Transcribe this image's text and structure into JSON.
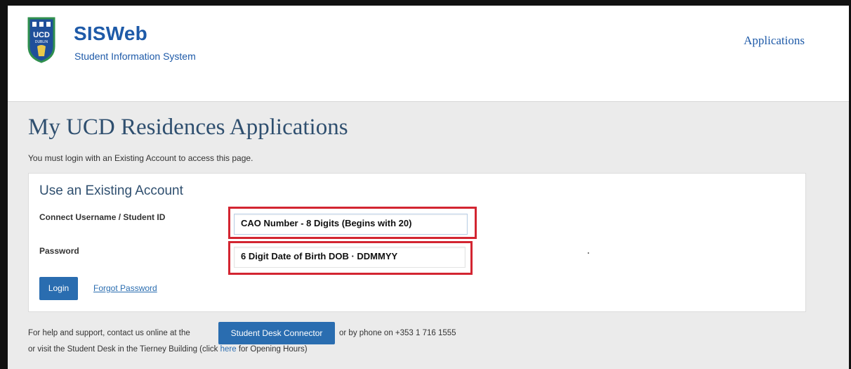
{
  "header": {
    "logo_text": "UCD DUBLIN",
    "title": "SISWeb",
    "subtitle": "Student Information System",
    "nav_applications": "Applications"
  },
  "main": {
    "page_title": "My UCD Residences Applications",
    "notice": "You must login with an Existing Account to access this page."
  },
  "login": {
    "panel_title": "Use an Existing Account",
    "username_label": "Connect Username / Student ID",
    "username_value": "CAO Number - 8 Digits (Begins with 20)",
    "password_label": "Password",
    "password_value": "6 Digit Date of Birth DOB · DDMMYY",
    "login_button": "Login",
    "forgot_password": "Forgot Password"
  },
  "help": {
    "line1_before": "For help and support, contact us online at the",
    "connector_button": "Student Desk Connector",
    "line1_after": "or by phone on +353 1 716 1555",
    "line2_before": "or visit the Student Desk in the Tierney Building (click",
    "here_link": "here",
    "line2_after": "for Opening Hours)"
  },
  "colors": {
    "brand_blue": "#1e5aa8",
    "button_blue": "#2a6db0",
    "highlight_red": "#d32531",
    "crest_green": "#2f8f4e"
  }
}
